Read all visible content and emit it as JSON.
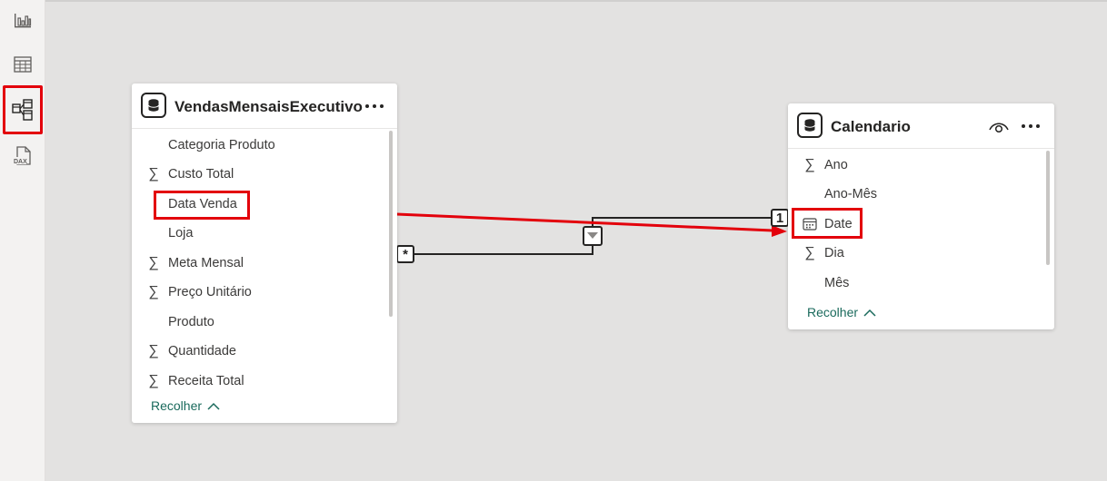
{
  "rail": {
    "items": [
      {
        "name": "report-view",
        "icon": "bar-chart-icon"
      },
      {
        "name": "table-view",
        "icon": "table-grid-icon"
      },
      {
        "name": "model-view",
        "icon": "model-diagram-icon",
        "active": true
      },
      {
        "name": "dax-query-view",
        "icon": "dax-icon",
        "label": "DAX"
      }
    ]
  },
  "tables": {
    "vendas": {
      "title": "VendasMensaisExecutivo",
      "fields": [
        {
          "label": "Categoria Produto",
          "sigma": false
        },
        {
          "label": "Custo Total",
          "sigma": true
        },
        {
          "label": "Data Venda",
          "sigma": false,
          "highlighted": true
        },
        {
          "label": "Loja",
          "sigma": false
        },
        {
          "label": "Meta Mensal",
          "sigma": true
        },
        {
          "label": "Preço Unitário",
          "sigma": true
        },
        {
          "label": "Produto",
          "sigma": false
        },
        {
          "label": "Quantidade",
          "sigma": true
        },
        {
          "label": "Receita Total",
          "sigma": true
        }
      ],
      "collapse_label": "Recolher"
    },
    "calendario": {
      "title": "Calendario",
      "fields": [
        {
          "label": "Ano",
          "sigma": true
        },
        {
          "label": "Ano-Mês",
          "sigma": false
        },
        {
          "label": "Date",
          "sigma": false,
          "calendar": true,
          "highlighted": true
        },
        {
          "label": "Dia",
          "sigma": true
        },
        {
          "label": "Mês",
          "sigma": false
        }
      ],
      "collapse_label": "Recolher"
    }
  },
  "relationship": {
    "many_side": "*",
    "one_side": "1",
    "filter_direction": "single"
  },
  "colors": {
    "highlight": "#e3000b",
    "canvas": "#e3e2e1",
    "collapse_link": "#1a6a5c"
  },
  "icons": {
    "sigma": "∑"
  }
}
